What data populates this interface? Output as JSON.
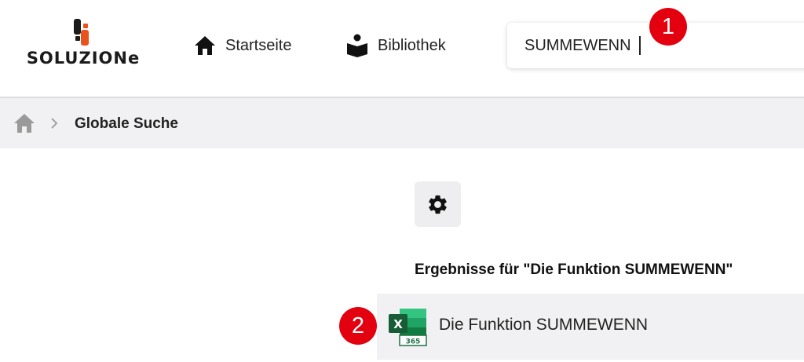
{
  "brand": {
    "name": "SOLUZIONe"
  },
  "nav": {
    "home_label": "Startseite",
    "library_label": "Bibliothek"
  },
  "search": {
    "value": "SUMMEWENN"
  },
  "breadcrumb": {
    "current": "Globale Suche"
  },
  "results": {
    "heading": "Ergebnisse für \"Die Funktion SUMMEWENN\"",
    "items": [
      {
        "label": "Die Funktion SUMMEWENN",
        "icon": "excel-365-icon",
        "icon_badge": "365"
      }
    ]
  },
  "annotations": {
    "step1": "1",
    "step2": "2"
  },
  "colors": {
    "accent_red": "#e3000f",
    "logo_orange": "#e8521b",
    "excel_green": "#1e7145",
    "breadcrumb_bg": "#f1f1f3"
  },
  "icons": {
    "nav_home": "home-icon",
    "nav_library": "library-reader-icon",
    "breadcrumb_home": "home-icon",
    "breadcrumb_separator": "chevron-right-icon",
    "settings": "gear-icon"
  }
}
